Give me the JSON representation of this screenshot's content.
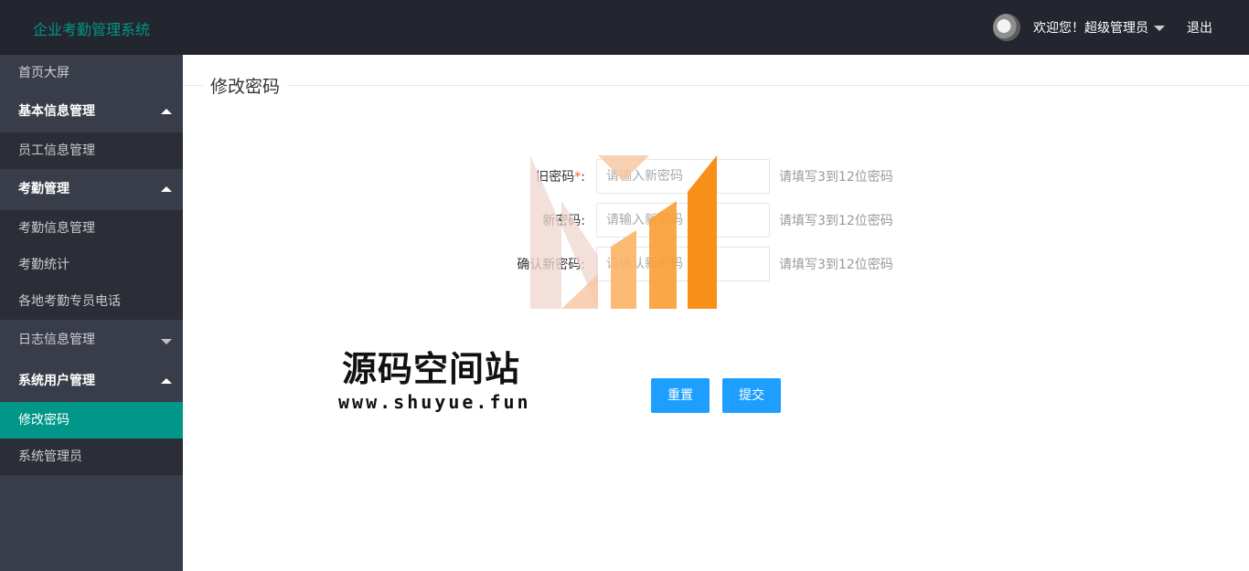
{
  "header": {
    "logo": "企业考勤管理系统",
    "welcome": "欢迎您！超级管理员",
    "logout": "退出"
  },
  "sidebar": {
    "items": [
      {
        "label": "首页大屏"
      },
      {
        "label": "基本信息管理"
      },
      {
        "label": "员工信息管理"
      },
      {
        "label": "考勤管理"
      },
      {
        "label": "考勤信息管理"
      },
      {
        "label": "考勤统计"
      },
      {
        "label": "各地考勤专员电话"
      },
      {
        "label": "日志信息管理"
      },
      {
        "label": "系统用户管理"
      },
      {
        "label": "修改密码"
      },
      {
        "label": "系统管理员"
      }
    ]
  },
  "main": {
    "title": "修改密码",
    "form": {
      "old_password": {
        "label": "旧密码",
        "required": "*",
        "colon": ":",
        "placeholder": "请输入新密码",
        "tip": "请填写3到12位密码"
      },
      "new_password": {
        "label": "新密码",
        "colon": ":",
        "placeholder": "请输入新密码",
        "tip": "请填写3到12位密码"
      },
      "confirm_password": {
        "label": "确认新密码",
        "colon": ":",
        "placeholder": "请确认新密码",
        "tip": "请填写3到12位密码"
      }
    },
    "buttons": {
      "reset": "重置",
      "submit": "提交"
    }
  },
  "watermark": {
    "title": "源码空间站",
    "url": "www.shuyue.fun"
  },
  "colors": {
    "header_bg": "#23262e",
    "sidebar_bg": "#393d49",
    "sidebar_sub_bg": "#2b2e37",
    "accent": "#009688",
    "button": "#1e9fff",
    "watermark_orange": "#f78a0e"
  }
}
